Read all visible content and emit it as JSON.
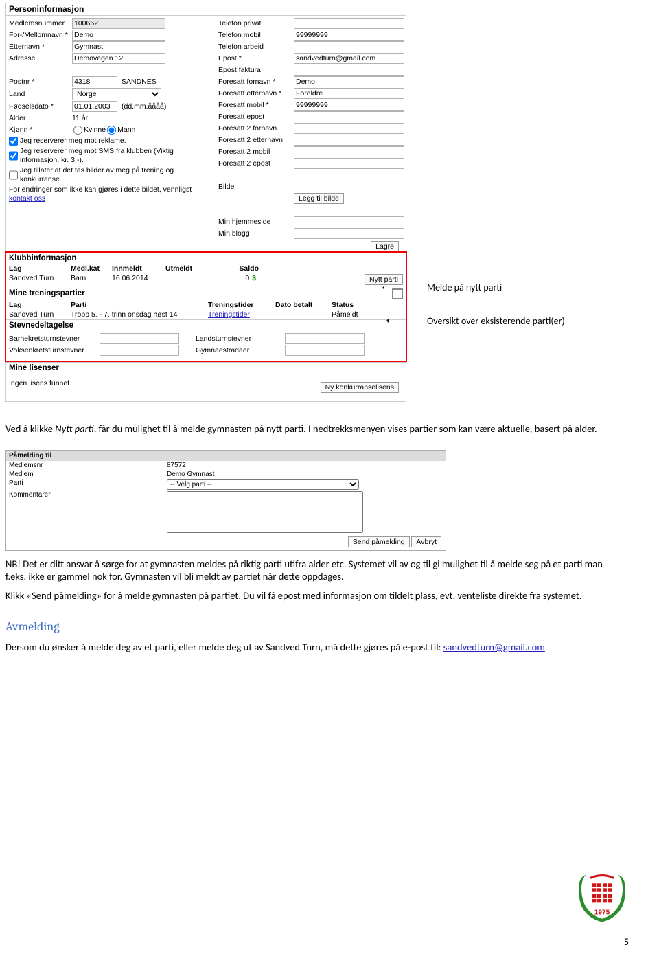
{
  "person": {
    "heading": "Personinformasjon",
    "left_labels": {
      "medlemsnummer": "Medlemsnummer",
      "fornavn": "For-/Mellomnavn *",
      "etternavn": "Etternavn *",
      "adresse": "Adresse",
      "postnr": "Postnr *",
      "land": "Land",
      "fodselsdato": "Fødselsdato *",
      "alder": "Alder",
      "kjonn": "Kjønn *"
    },
    "left_values": {
      "medlemsnummer": "100662",
      "fornavn": "Demo",
      "etternavn": "Gymnast",
      "adresse": "Demovegen 12",
      "postnr": "4318",
      "poststed": "SANDNES",
      "land": "Norge",
      "fodselsdato": "01.01.2003",
      "fodselsdato_hint": "(dd.mm.åååå)",
      "alder": "11 år",
      "kjonn_kvinne": "Kvinne",
      "kjonn_mann": "Mann"
    },
    "right_labels": {
      "tlf_privat": "Telefon privat",
      "tlf_mobil": "Telefon mobil",
      "tlf_arbeid": "Telefon arbeid",
      "epost": "Epost *",
      "epost_faktura": "Epost faktura",
      "f_fornavn": "Foresatt fornavn *",
      "f_etternavn": "Foresatt etternavn *",
      "f_mobil": "Foresatt mobil *",
      "f_epost": "Foresatt epost",
      "f2_fornavn": "Foresatt 2 fornavn",
      "f2_etternavn": "Foresatt 2 etternavn",
      "f2_mobil": "Foresatt 2 mobil",
      "f2_epost": "Foresatt 2 epost",
      "bilde": "Bilde",
      "min_hjemmeside": "Min hjemmeside",
      "min_blogg": "Min blogg"
    },
    "right_values": {
      "tlf_mobil": "99999999",
      "epost": "sandvedturn@gmail.com",
      "f_fornavn": "Demo",
      "f_etternavn": "Foreldre",
      "f_mobil": "99999999",
      "legg_til_bilde": "Legg til bilde"
    },
    "checks": {
      "reklame": "Jeg reserverer meg mot reklame.",
      "sms": "Jeg reserverer meg mot SMS fra klubben (Viktig informasjon, kr. 3,-).",
      "bilder": "Jeg tillater at det tas bilder av meg på trening og konkurranse."
    },
    "contact_note": "For endringer som ikke kan gjøres i dette bildet, vennligst ",
    "contact_link": "kontakt oss",
    "lagre": "Lagre"
  },
  "klubb": {
    "heading": "Klubbinformasjon",
    "cols": {
      "lag": "Lag",
      "medlkat": "Medl.kat",
      "innmeldt": "Innmeldt",
      "utmeldt": "Utmeldt",
      "saldo": "Saldo"
    },
    "row": {
      "lag": "Sandved Turn",
      "medlkat": "Barn",
      "innmeldt": "16.06.2014",
      "utmeldt": "",
      "saldo": "0"
    },
    "nytt_parti": "Nytt parti",
    "trenings_head": "Mine treningspartier",
    "tcols": {
      "lag": "Lag",
      "parti": "Parti",
      "treningstider": "Treningstider",
      "dato_betalt": "Dato betalt",
      "status": "Status"
    },
    "trow": {
      "lag": "Sandved Turn",
      "parti": "Tropp 5. - 7. trinn onsdag høst 14",
      "treningstider": "Treningstider",
      "status": "Påmeldt"
    },
    "stevne_head": "Stevnedeltagelse",
    "stevne": {
      "barnekrets": "Barnekretsturnstevner",
      "voksenkrets": "Voksenkretsturnstevner",
      "landsturn": "Landsturnstevner",
      "gymnaestrada": "Gymnaestradaer"
    }
  },
  "lisens": {
    "heading": "Mine lisenser",
    "none": "Ingen lisens funnet",
    "ny": "Ny konkurranselisens"
  },
  "annot": {
    "nytt": "Melde på nytt parti",
    "eksist": "Oversikt over eksisterende parti(er)"
  },
  "dialog": {
    "hdr": "Påmelding til",
    "medlemsnr_l": "Medlemsnr",
    "medlemsnr": "87572",
    "medlem_l": "Medlem",
    "medlem": "Demo Gymnast",
    "parti_l": "Parti",
    "parti_opt": "-- Velg parti --",
    "komment_l": "Kommentarer",
    "send": "Send påmelding",
    "avbryt": "Avbryt"
  },
  "text": {
    "p1a": "Ved å klikke ",
    "p1i": "Nytt parti",
    "p1b": ", får du mulighet til å melde gymnasten på nytt parti. I nedtrekksmenyen vises partier som kan være aktuelle, basert på alder.",
    "p2": "NB! Det er ditt ansvar å sørge for at gymnasten meldes på riktig parti utifra alder etc. Systemet vil av og til gi mulighet til å melde seg på et parti man f.eks. ikke er gammel nok for. Gymnasten vil bli meldt av partiet når dette oppdages.",
    "p3": "Klikk «Send påmelding» for å melde gymnasten på partiet. Du vil få epost med informasjon om tildelt plass, evt. venteliste direkte fra systemet.",
    "h2": "Avmelding",
    "p4a": "Dersom du ønsker å melde deg av et parti, eller melde deg ut av Sandved Turn, må dette gjøres på e-post til: ",
    "p4link": "sandvedturn@gmail.com"
  },
  "page_num": "5",
  "logo_year": "1975"
}
